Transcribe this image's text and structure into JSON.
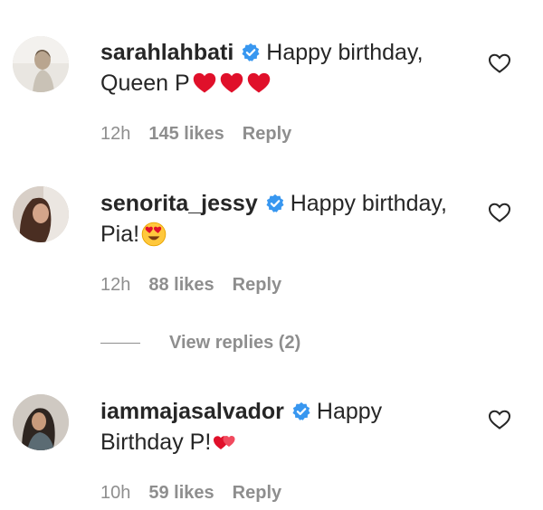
{
  "comments": [
    {
      "username": "sarahlahbati",
      "verified": true,
      "text": "Happy birthday, Queen P",
      "emoji": [
        "red-heart",
        "red-heart",
        "red-heart"
      ],
      "time": "12h",
      "likes": "145 likes",
      "reply": "Reply"
    },
    {
      "username": "senorita_jessy",
      "verified": true,
      "text": "Happy birthday, Pia!",
      "emoji": [
        "heart-eyes-face"
      ],
      "time": "12h",
      "likes": "88 likes",
      "reply": "Reply",
      "view_replies": "View replies (2)"
    },
    {
      "username": "iammajasalvador",
      "verified": true,
      "text": "Happy Birthday P!",
      "emoji": [
        "two-hearts"
      ],
      "time": "10h",
      "likes": "59 likes",
      "reply": "Reply"
    }
  ],
  "colors": {
    "text": "#262626",
    "meta": "#8e8e8e",
    "verified": "#3897f0",
    "heart": "#e0102a"
  }
}
